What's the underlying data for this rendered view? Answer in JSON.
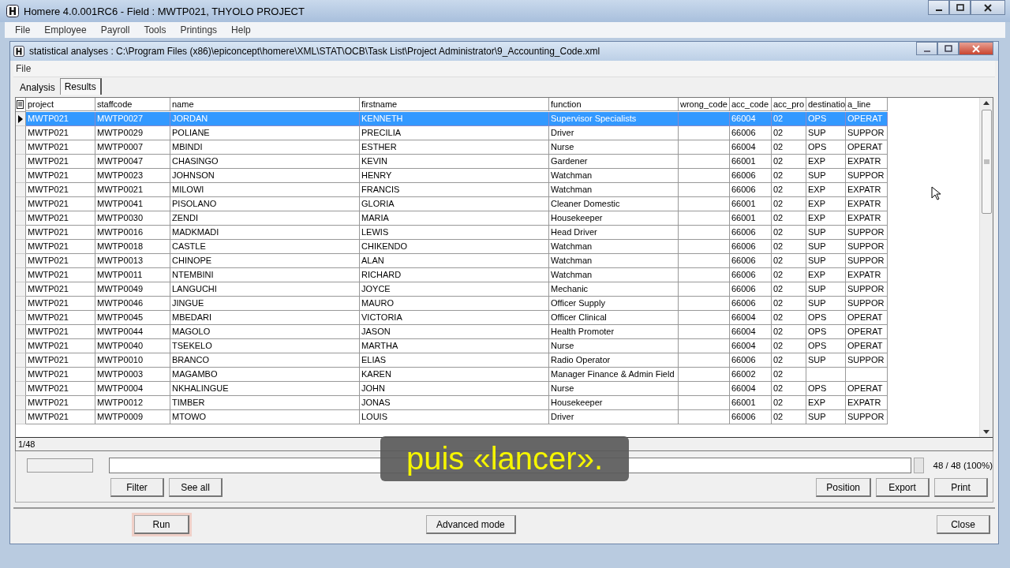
{
  "window": {
    "title": "Homere 4.0.001RC6 - Field : MWTP021, THYOLO PROJECT"
  },
  "menu": [
    "File",
    "Employee",
    "Payroll",
    "Tools",
    "Printings",
    "Help"
  ],
  "child_window": {
    "title": "statistical analyses : C:\\Program Files (x86)\\epiconcept\\homere\\XML\\STAT\\OCB\\Task List\\Project Administrator\\9_Accounting_Code.xml",
    "menu": [
      "File"
    ],
    "tabs": [
      {
        "label": "Analysis",
        "selected": false
      },
      {
        "label": "Results",
        "selected": true
      }
    ],
    "table": {
      "columns": [
        "project",
        "staffcode",
        "name",
        "firstname",
        "function",
        "wrong_code",
        "acc_code",
        "acc_pro",
        "destinatio",
        "a_line"
      ],
      "rows": [
        {
          "selected": true,
          "cells": [
            "MWTP021",
            "MWTP0027",
            "JORDAN",
            "KENNETH",
            "Supervisor Specialists",
            null,
            "66004",
            "02",
            "OPS",
            "OPERAT"
          ]
        },
        {
          "selected": false,
          "cells": [
            "MWTP021",
            "MWTP0029",
            "POLIANE",
            "PRECILIA",
            "Driver",
            null,
            "66006",
            "02",
            "SUP",
            "SUPPOR"
          ]
        },
        {
          "selected": false,
          "cells": [
            "MWTP021",
            "MWTP0007",
            "MBINDI",
            "ESTHER",
            "Nurse",
            null,
            "66004",
            "02",
            "OPS",
            "OPERAT"
          ]
        },
        {
          "selected": false,
          "cells": [
            "MWTP021",
            "MWTP0047",
            "CHASINGO",
            "KEVIN",
            "Gardener",
            null,
            "66001",
            "02",
            "EXP",
            "EXPATR"
          ]
        },
        {
          "selected": false,
          "cells": [
            "MWTP021",
            "MWTP0023",
            "JOHNSON",
            "HENRY",
            "Watchman",
            null,
            "66006",
            "02",
            "SUP",
            "SUPPOR"
          ]
        },
        {
          "selected": false,
          "cells": [
            "MWTP021",
            "MWTP0021",
            "MILOWI",
            "FRANCIS",
            "Watchman",
            null,
            "66006",
            "02",
            "EXP",
            "EXPATR"
          ]
        },
        {
          "selected": false,
          "cells": [
            "MWTP021",
            "MWTP0041",
            "PISOLANO",
            "GLORIA",
            "Cleaner Domestic",
            null,
            "66001",
            "02",
            "EXP",
            "EXPATR"
          ]
        },
        {
          "selected": false,
          "cells": [
            "MWTP021",
            "MWTP0030",
            "ZENDI",
            "MARIA",
            "Housekeeper",
            null,
            "66001",
            "02",
            "EXP",
            "EXPATR"
          ]
        },
        {
          "selected": false,
          "cells": [
            "MWTP021",
            "MWTP0016",
            "MADKMADI",
            "LEWIS",
            "Head Driver",
            null,
            "66006",
            "02",
            "SUP",
            "SUPPOR"
          ]
        },
        {
          "selected": false,
          "cells": [
            "MWTP021",
            "MWTP0018",
            "CASTLE",
            "CHIKENDO",
            "Watchman",
            null,
            "66006",
            "02",
            "SUP",
            "SUPPOR"
          ]
        },
        {
          "selected": false,
          "cells": [
            "MWTP021",
            "MWTP0013",
            "CHINOPE",
            "ALAN",
            "Watchman",
            null,
            "66006",
            "02",
            "SUP",
            "SUPPOR"
          ]
        },
        {
          "selected": false,
          "cells": [
            "MWTP021",
            "MWTP0011",
            "NTEMBINI",
            "RICHARD",
            "Watchman",
            null,
            "66006",
            "02",
            "EXP",
            "EXPATR"
          ]
        },
        {
          "selected": false,
          "cells": [
            "MWTP021",
            "MWTP0049",
            "LANGUCHI",
            "JOYCE",
            "Mechanic",
            null,
            "66006",
            "02",
            "SUP",
            "SUPPOR"
          ]
        },
        {
          "selected": false,
          "cells": [
            "MWTP021",
            "MWTP0046",
            "JINGUE",
            "MAURO",
            "Officer Supply",
            null,
            "66006",
            "02",
            "SUP",
            "SUPPOR"
          ]
        },
        {
          "selected": false,
          "cells": [
            "MWTP021",
            "MWTP0045",
            "MBEDARI",
            "VICTORIA",
            "Officer Clinical",
            null,
            "66004",
            "02",
            "OPS",
            "OPERAT"
          ]
        },
        {
          "selected": false,
          "cells": [
            "MWTP021",
            "MWTP0044",
            "MAGOLO",
            "JASON",
            "Health Promoter",
            null,
            "66004",
            "02",
            "OPS",
            "OPERAT"
          ]
        },
        {
          "selected": false,
          "cells": [
            "MWTP021",
            "MWTP0040",
            "TSEKELO",
            "MARTHA",
            "Nurse",
            null,
            "66004",
            "02",
            "OPS",
            "OPERAT"
          ]
        },
        {
          "selected": false,
          "cells": [
            "MWTP021",
            "MWTP0010",
            "BRANCO",
            "ELIAS",
            "Radio Operator",
            null,
            "66006",
            "02",
            "SUP",
            "SUPPOR"
          ]
        },
        {
          "selected": false,
          "cells": [
            "MWTP021",
            "MWTP0003",
            "MAGAMBO",
            "KAREN",
            "Manager Finance & Admin Field",
            null,
            "66002",
            "02",
            null,
            null
          ]
        },
        {
          "selected": false,
          "cells": [
            "MWTP021",
            "MWTP0004",
            "NKHALINGUE",
            "JOHN",
            "Nurse",
            null,
            "66004",
            "02",
            "OPS",
            "OPERAT"
          ]
        },
        {
          "selected": false,
          "cells": [
            "MWTP021",
            "MWTP0012",
            "TIMBER",
            "JONAS",
            "Housekeeper",
            null,
            "66001",
            "02",
            "EXP",
            "EXPATR"
          ]
        },
        {
          "selected": false,
          "cells": [
            "MWTP021",
            "MWTP0009",
            "MTOWO",
            "LOUIS",
            "Driver",
            null,
            "66006",
            "02",
            "SUP",
            "SUPPOR"
          ]
        }
      ]
    },
    "record_position": "1/48",
    "progress_reading": "48 / 48 (100%)",
    "filter_buttons": [
      "Filter",
      "See all"
    ],
    "output_buttons": [
      "Position",
      "Export",
      "Print"
    ],
    "footer_buttons": [
      {
        "label": "Run",
        "focused": true
      },
      {
        "label": "Advanced mode",
        "focused": false
      },
      {
        "label": "Close",
        "focused": false
      }
    ]
  },
  "subtitle": "puis «lancer»."
}
